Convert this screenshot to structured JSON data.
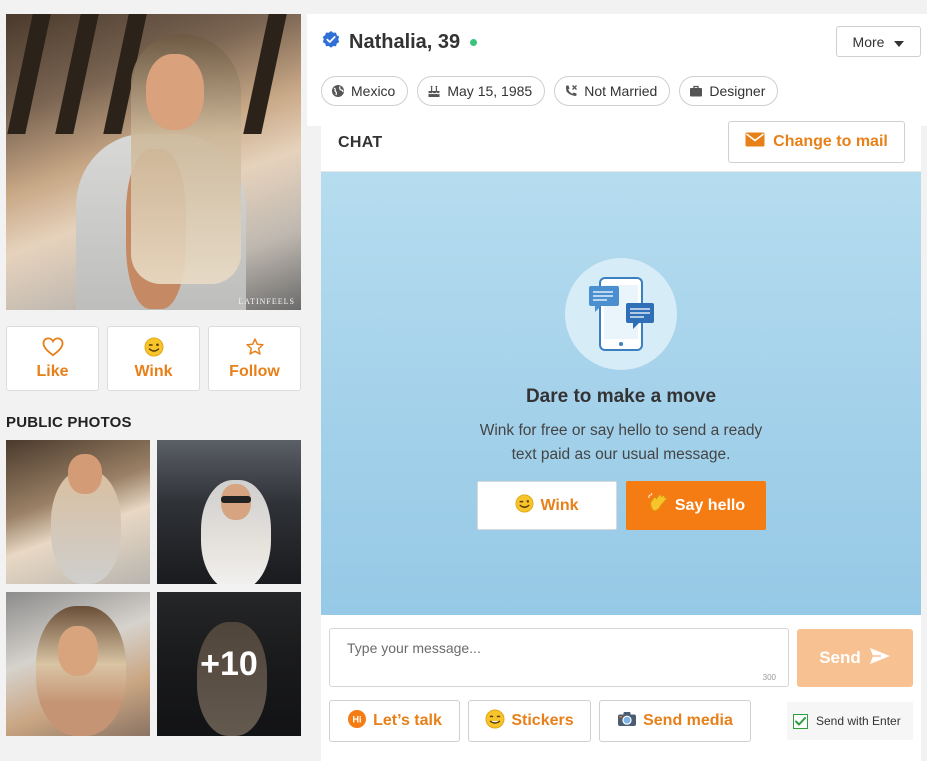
{
  "profile": {
    "name_age": "Nathalia, 39",
    "more_label": "More",
    "chips": {
      "country": "Mexico",
      "birthday": "May 15, 1985",
      "status": "Not Married",
      "job": "Designer"
    }
  },
  "main_photo": {
    "watermark": "LATINFEELS"
  },
  "actions": {
    "like": "Like",
    "wink": "Wink",
    "follow": "Follow"
  },
  "public_photos": {
    "title": "PUBLIC PHOTOS",
    "more_count": "+10"
  },
  "chat": {
    "title": "CHAT",
    "change_mail_label": "Change to mail",
    "prompt_title": "Dare to make a move",
    "prompt_sub": "Wink for free or say hello to send a ready text paid as our usual message.",
    "wink_label": "Wink",
    "hello_label": "Say hello",
    "input_placeholder": "Type your message...",
    "char_limit": "300",
    "send_label": "Send",
    "lets_talk_label": "Let’s talk",
    "stickers_label": "Stickers",
    "send_media_label": "Send media",
    "send_with_enter_label": "Send with Enter",
    "send_with_enter_checked": true
  },
  "colors": {
    "accent": "#e8801a",
    "accent_button": "#f57c12",
    "send_disabled": "#f7c192",
    "online": "#39c47a",
    "verified": "#2f6fd6",
    "chat_bg": "#a3d1ea"
  }
}
